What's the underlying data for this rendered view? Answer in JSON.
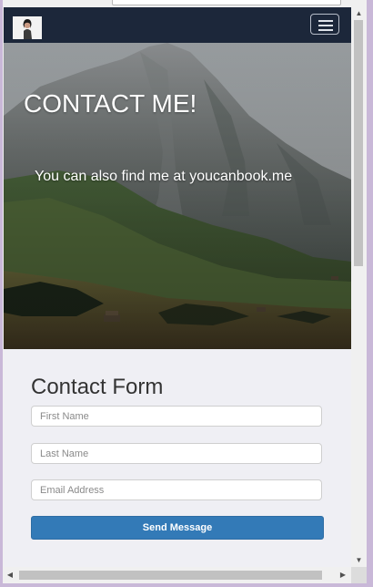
{
  "hero": {
    "title": "CONTACT ME!",
    "subtitle": "You can also find me at youcanbook.me"
  },
  "contact_form": {
    "title": "Contact Form",
    "first_name_placeholder": "First Name",
    "last_name_placeholder": "Last Name",
    "email_placeholder": "Email Address",
    "submit_label": "Send Message"
  },
  "icons": {
    "nav_toggle": "hamburger-menu-icon",
    "scroll_up": "triangle-up-icon",
    "scroll_down": "triangle-down-icon",
    "scroll_left": "triangle-left-icon",
    "scroll_right": "triangle-right-icon"
  },
  "colors": {
    "navbar": "#1c273a",
    "page_background": "#efeff4",
    "primary_button": "#337ab7"
  }
}
